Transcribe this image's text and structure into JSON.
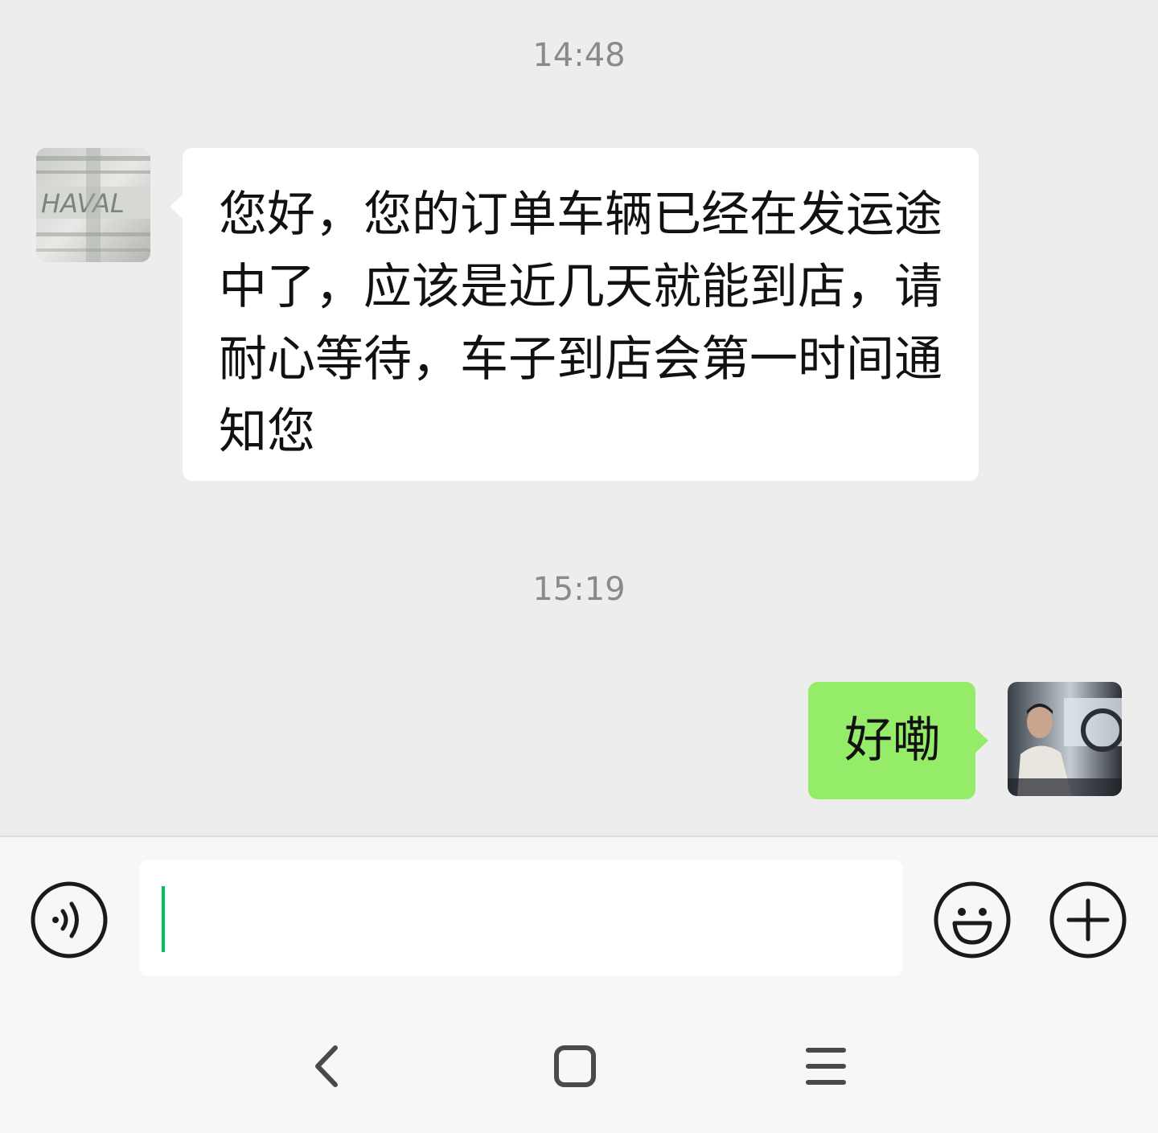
{
  "chat": {
    "timestamps": [
      "14:48",
      "15:19"
    ],
    "messages": [
      {
        "sender": "other",
        "text": "您好，您的订单车辆已经在发运途中了，应该是近几天就能到店，请耐心等待，车子到店会第一时间通知您"
      },
      {
        "sender": "self",
        "text": "好嘞"
      }
    ]
  },
  "colors": {
    "background": "#ededed",
    "incoming_bubble": "#ffffff",
    "outgoing_bubble": "#95ec69",
    "cursor": "#07c160",
    "timestamp_text": "#8a8a8a"
  },
  "input_bar": {
    "value": "",
    "icons": [
      "voice-icon",
      "emoji-icon",
      "plus-icon"
    ]
  },
  "nav_bar": {
    "icons": [
      "back-icon",
      "home-icon",
      "menu-icon"
    ]
  }
}
